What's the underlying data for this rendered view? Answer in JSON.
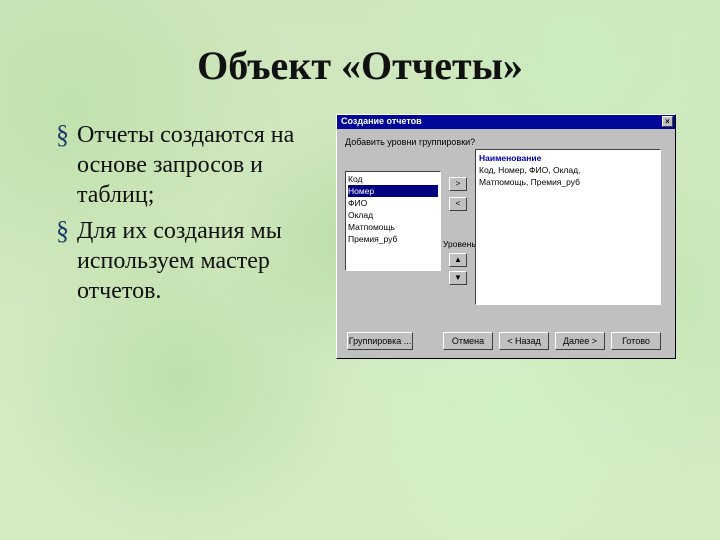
{
  "slide": {
    "title": "Объект «Отчеты»",
    "bullets": [
      "Отчеты создаются на основе запросов и таблиц;",
      "Для их создания мы используем мастер отчетов."
    ]
  },
  "dialog": {
    "title": "Создание отчетов",
    "prompt": "Добавить уровни группировки?",
    "fields": {
      "items": [
        "Код",
        "Номер",
        "ФИО",
        "Оклад",
        "Матпомощь",
        "Премия_руб"
      ],
      "selected_index": 1
    },
    "preview": {
      "header": "Наименование",
      "line1": "Код, Номер, ФИО, Оклад,",
      "line2": "Матпомощь, Премия_руб"
    },
    "mid_buttons": {
      "add": ">",
      "remove": "<",
      "label": "Уровень",
      "up": "▲",
      "down": "▼"
    },
    "bottom_buttons": {
      "group": "Группировка ...",
      "cancel": "Отмена",
      "back": "< Назад",
      "next": "Далее >",
      "finish": "Готово"
    }
  }
}
